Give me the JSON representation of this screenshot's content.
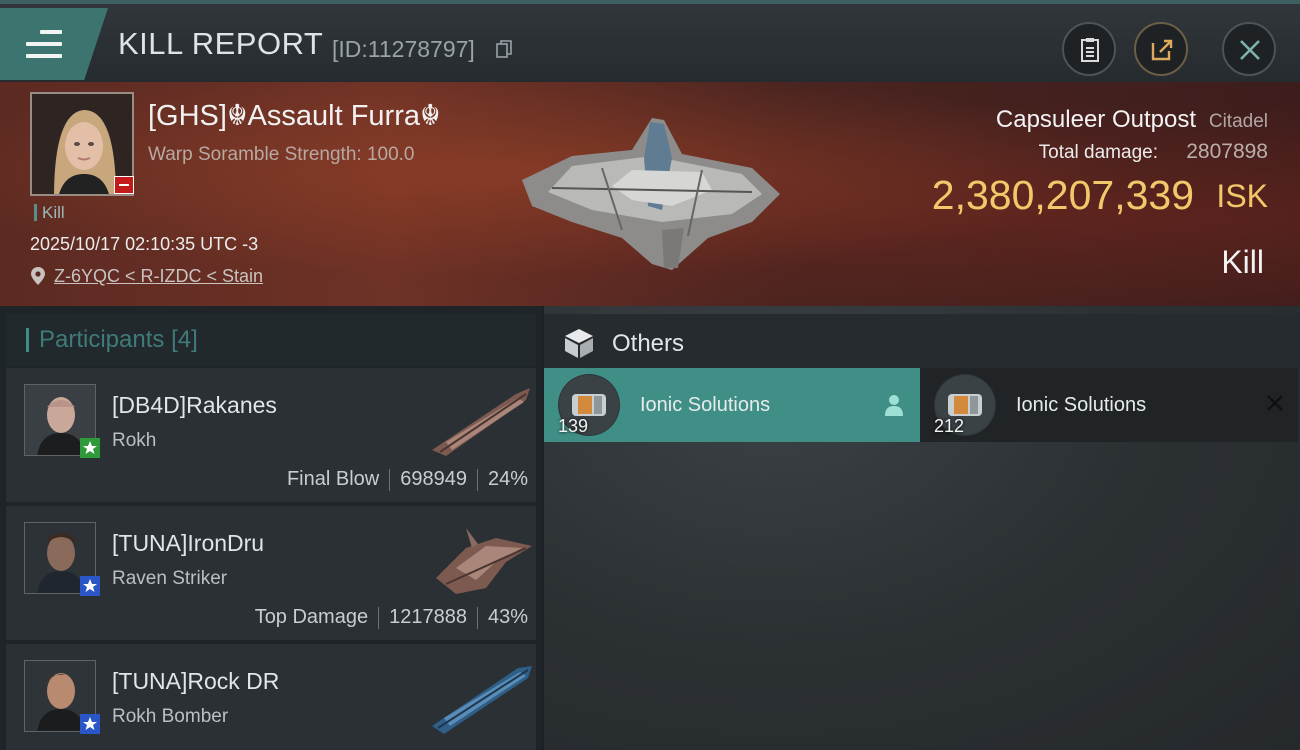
{
  "header": {
    "title": "KILL REPORT",
    "report_id": "[ID:11278797]"
  },
  "victim": {
    "name": "[GHS]☬Assault Furra☬",
    "subtitle": "Warp Soramble Strength: 100.0",
    "tag": "Kill",
    "datetime": "2025/10/17 02:10:35 UTC -3",
    "location": "Z-6YQC < R-IZDC < Stain",
    "structure_name": "Capsuleer Outpost",
    "structure_type": "Citadel",
    "damage_label": "Total damage:",
    "damage_value": "2807898",
    "isk_value": "2,380,207,339",
    "isk_unit": "ISK",
    "result": "Kill"
  },
  "participants": {
    "label": "Participants",
    "count": "[4]",
    "rows": [
      {
        "name": "[DB4D]Rakanes",
        "ship": "Rokh",
        "role": "Final Blow",
        "damage": "698949",
        "percent": "24%",
        "star_color": "#2f9a3a"
      },
      {
        "name": "[TUNA]IronDru",
        "ship": "Raven Striker",
        "role": "Top Damage",
        "damage": "1217888",
        "percent": "43%",
        "star_color": "#2a56c8"
      },
      {
        "name": "[TUNA]Rock DR",
        "ship": "Rokh Bomber",
        "role": "",
        "damage": "",
        "percent": "",
        "star_color": "#2a56c8"
      }
    ]
  },
  "others": {
    "title": "Others",
    "items": [
      {
        "quantity": "139",
        "name": "Ionic Solutions",
        "selected": true
      },
      {
        "quantity": "212",
        "name": "Ionic Solutions",
        "selected": false
      }
    ]
  },
  "colors": {
    "accent": "#3f8f86",
    "isk": "#f2c86a",
    "danger": "#c41a1a"
  },
  "icons": [
    "menu-icon",
    "copy-icon",
    "clipboard-icon",
    "share-icon",
    "close-icon",
    "location-pin-icon",
    "cube-icon",
    "pilot-icon",
    "close-x-icon",
    "star-icon"
  ]
}
